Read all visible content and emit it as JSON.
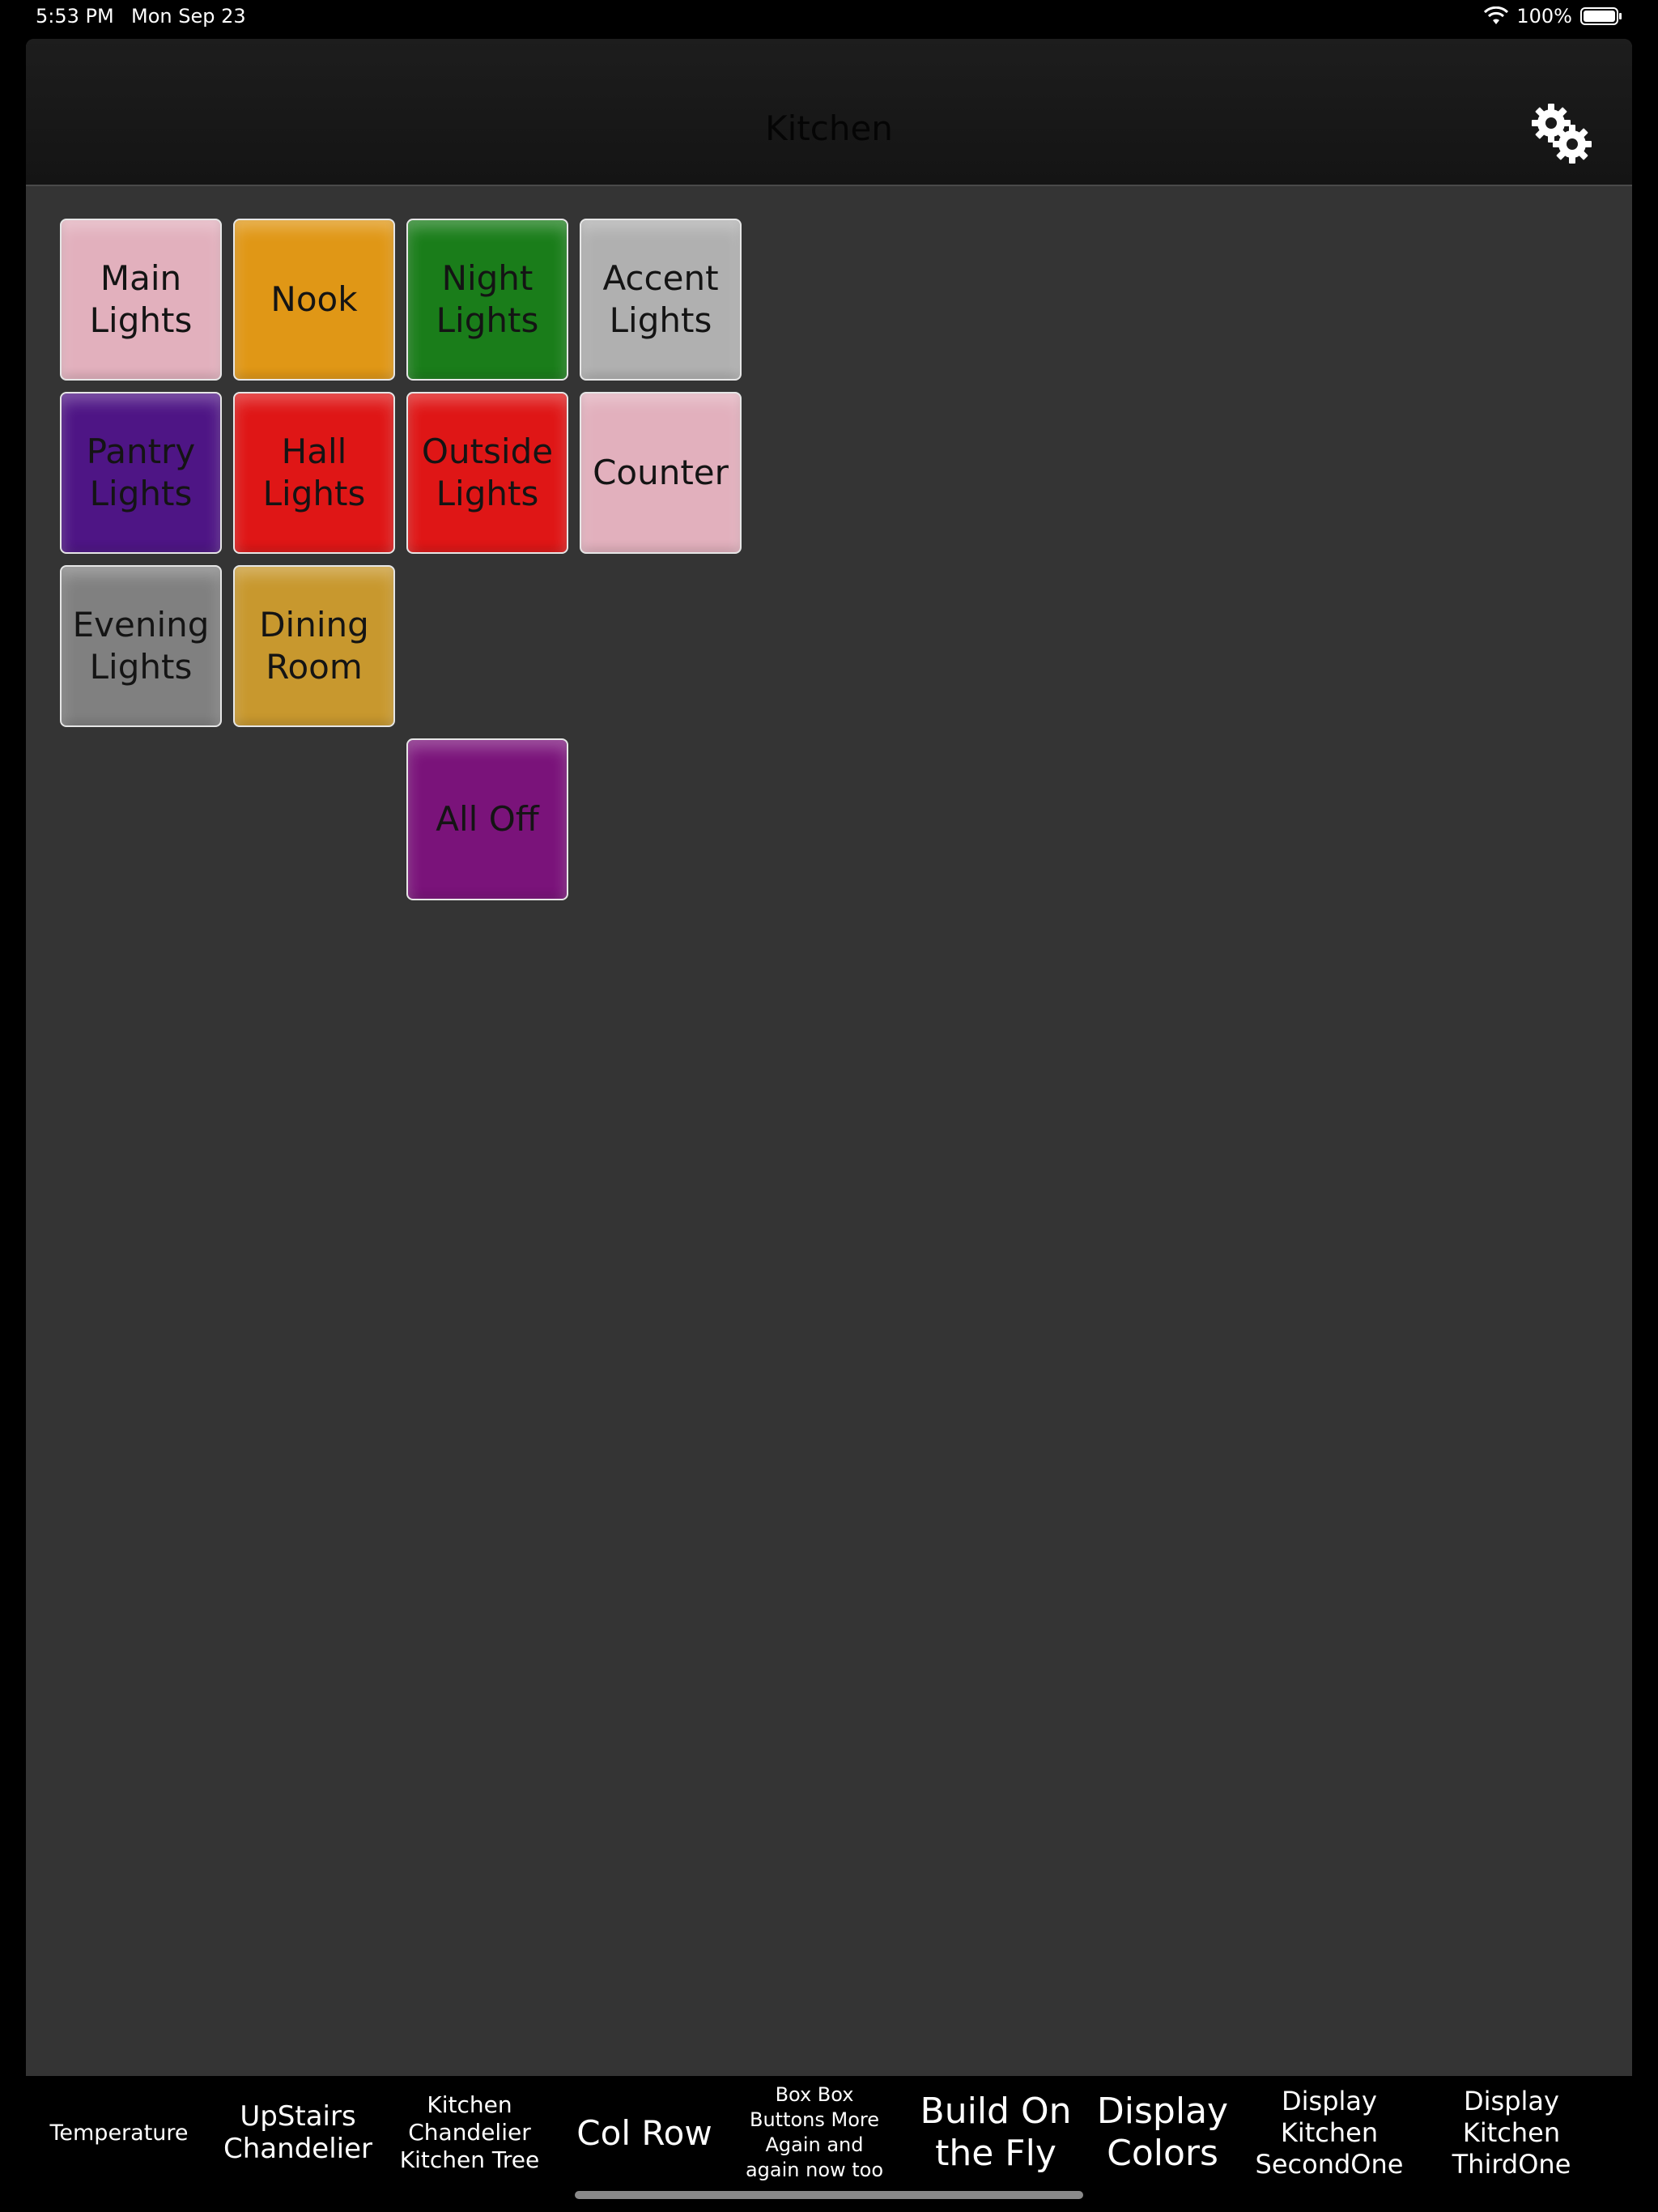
{
  "status": {
    "time": "5:53 PM",
    "date": "Mon Sep 23",
    "battery": "100%"
  },
  "nav": {
    "title": "Kitchen",
    "settings_icon": "gears-icon"
  },
  "buttons": [
    {
      "label": "Main\nLights",
      "color": "#e2b0bd"
    },
    {
      "label": "Nook",
      "color": "#e09716"
    },
    {
      "label": "Night\nLights",
      "color": "#1a7d1a"
    },
    {
      "label": "Accent\nLights",
      "color": "#b0b0b0"
    },
    {
      "label": "Pantry\nLights",
      "color": "#4e1585"
    },
    {
      "label": "Hall\nLights",
      "color": "#df1616"
    },
    {
      "label": "Outside\nLights",
      "color": "#df1616"
    },
    {
      "label": "Counter",
      "color": "#e2b0bd"
    },
    {
      "label": "Evening\nLights",
      "color": "#808080"
    },
    {
      "label": "Dining\nRoom",
      "color": "#c8982e"
    },
    {
      "label": "All Off",
      "color": "#7a137a"
    }
  ],
  "tabs": [
    {
      "label": "Temperature"
    },
    {
      "label": "UpStairs\nChandelier"
    },
    {
      "label": "Kitchen\nChandelier\nKitchen Tree"
    },
    {
      "label": "Col Row"
    },
    {
      "label": "Box Box\nButtons More\nAgain and\nagain now too"
    },
    {
      "label": "Build On\nthe Fly"
    },
    {
      "label": "Display\nColors"
    },
    {
      "label": "Display\nKitchen\nSecondOne"
    },
    {
      "label": "Display\nKitchen\nThirdOne"
    }
  ]
}
